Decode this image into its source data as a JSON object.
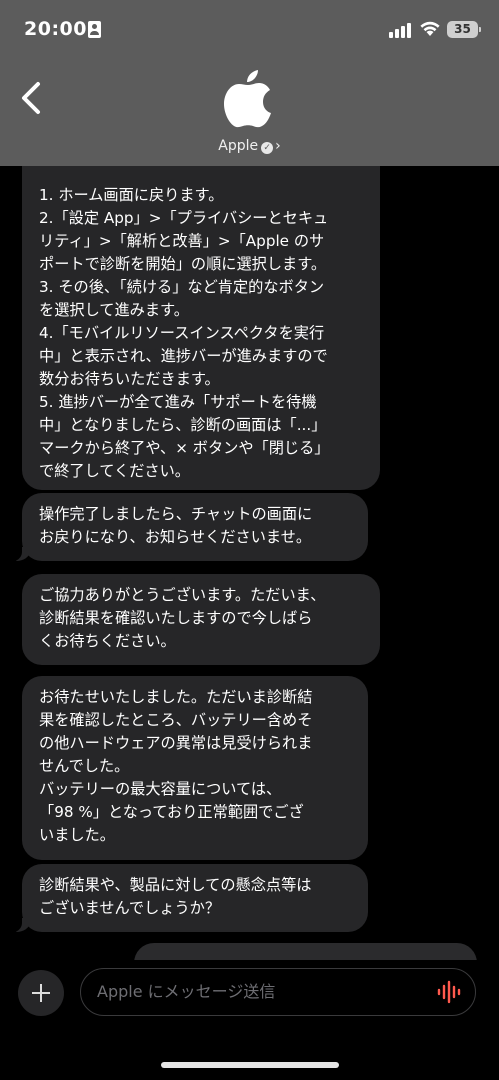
{
  "status_bar": {
    "time": "20:00",
    "battery": "35"
  },
  "header": {
    "contact_name": "Apple",
    "icons": [
      "back-chevron-icon",
      "apple-logo",
      "verified-badge-icon",
      "chevron-right-icon"
    ]
  },
  "messages": [
    {
      "direction": "incoming",
      "text": "1. ホーム画面に戻ります。\n2.「設定 App」>「プライバシーとセキュ\nリティ」>「解析と改善」>「Apple のサ\nポートで診断を開始」の順に選択します。\n3. その後、「続ける」など肯定的なボタン\nを選択して進みます。\n4.「モバイルリソースインスペクタを実行\n中」と表示され、進捗バーが進みますので\n数分お待ちいただきます。\n5. 進捗バーが全て進み「サポートを待機\n中」となりましたら、診断の画面は「...」\nマークから終了や、× ボタンや「閉じる」\nで終了してください。"
    },
    {
      "direction": "incoming",
      "text": "操作完了しましたら、チャットの画面に\nお戻りになり、お知らせくださいませ。"
    },
    {
      "direction": "incoming",
      "text": "ご協力ありがとうございます。ただいま、\n診断結果を確認いたしますので今しばら\nくお待ちください。"
    },
    {
      "direction": "incoming",
      "text": "お待たせいたしました。ただいま診断結\n果を確認したところ、バッテリー含めそ\nの他ハードウェアの異常は見受けられま\nせんでした。\nバッテリーの最大容量については、\n「98 %」となっており正常範囲でござ\nいました。"
    },
    {
      "direction": "incoming",
      "text": "診断結果や、製品に対しての懸念点等は\nございませんでしょうか？"
    }
  ],
  "composer": {
    "placeholder": "Apple にメッセージ送信",
    "icons": [
      "plus-icon",
      "voice-waveform-icon"
    ]
  },
  "colors": {
    "header_bg": "#5c5c5c",
    "bubble_bg": "#262628",
    "screen_bg": "#000000",
    "voice_accent": "#ff5a4e"
  }
}
